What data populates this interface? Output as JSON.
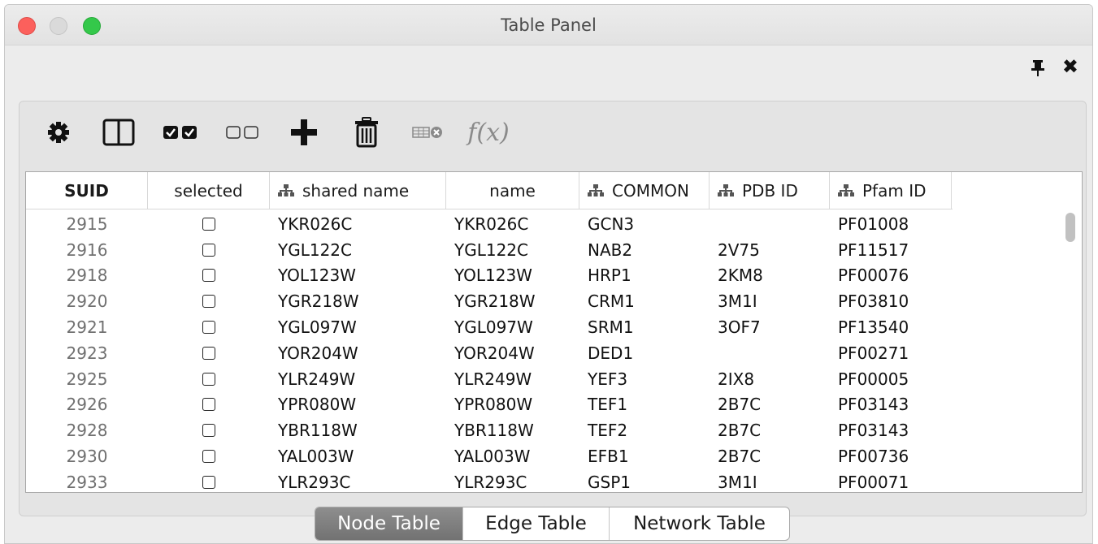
{
  "window": {
    "title": "Table Panel"
  },
  "toolbar": {
    "items": [
      {
        "icon": "gear-icon"
      },
      {
        "icon": "column-layout-icon"
      },
      {
        "icon": "select-all-icon"
      },
      {
        "icon": "deselect-all-icon"
      },
      {
        "icon": "add-icon"
      },
      {
        "icon": "trash-icon"
      },
      {
        "icon": "delete-table-icon"
      },
      {
        "icon": "function-builder-icon",
        "label": "f(x)"
      }
    ]
  },
  "table": {
    "columns": [
      {
        "label": "SUID",
        "tree": false
      },
      {
        "label": "selected",
        "tree": false
      },
      {
        "label": "shared name",
        "tree": true
      },
      {
        "label": "name",
        "tree": false
      },
      {
        "label": "COMMON",
        "tree": true
      },
      {
        "label": "PDB ID",
        "tree": true
      },
      {
        "label": "Pfam ID",
        "tree": true
      }
    ],
    "rows": [
      {
        "suid": "2915",
        "selected": false,
        "shared_name": "YKR026C",
        "name": "YKR026C",
        "common": "GCN3",
        "pdb": "",
        "pfam": "PF01008"
      },
      {
        "suid": "2916",
        "selected": false,
        "shared_name": "YGL122C",
        "name": "YGL122C",
        "common": "NAB2",
        "pdb": "2V75",
        "pfam": "PF11517"
      },
      {
        "suid": "2918",
        "selected": false,
        "shared_name": "YOL123W",
        "name": "YOL123W",
        "common": "HRP1",
        "pdb": "2KM8",
        "pfam": "PF00076"
      },
      {
        "suid": "2920",
        "selected": false,
        "shared_name": "YGR218W",
        "name": "YGR218W",
        "common": "CRM1",
        "pdb": "3M1I",
        "pfam": "PF03810"
      },
      {
        "suid": "2921",
        "selected": false,
        "shared_name": "YGL097W",
        "name": "YGL097W",
        "common": "SRM1",
        "pdb": "3OF7",
        "pfam": "PF13540"
      },
      {
        "suid": "2923",
        "selected": false,
        "shared_name": "YOR204W",
        "name": "YOR204W",
        "common": "DED1",
        "pdb": "",
        "pfam": "PF00271"
      },
      {
        "suid": "2925",
        "selected": false,
        "shared_name": "YLR249W",
        "name": "YLR249W",
        "common": "YEF3",
        "pdb": "2IX8",
        "pfam": "PF00005"
      },
      {
        "suid": "2926",
        "selected": false,
        "shared_name": "YPR080W",
        "name": "YPR080W",
        "common": "TEF1",
        "pdb": "2B7C",
        "pfam": "PF03143"
      },
      {
        "suid": "2928",
        "selected": false,
        "shared_name": "YBR118W",
        "name": "YBR118W",
        "common": "TEF2",
        "pdb": "2B7C",
        "pfam": "PF03143"
      },
      {
        "suid": "2930",
        "selected": false,
        "shared_name": "YAL003W",
        "name": "YAL003W",
        "common": "EFB1",
        "pdb": "2B7C",
        "pfam": "PF00736"
      },
      {
        "suid": "2933",
        "selected": false,
        "shared_name": "YLR293C",
        "name": "YLR293C",
        "common": "GSP1",
        "pdb": "3M1I",
        "pfam": "PF00071"
      }
    ]
  },
  "tabs": [
    {
      "label": "Node Table",
      "active": true
    },
    {
      "label": "Edge Table",
      "active": false
    },
    {
      "label": "Network Table",
      "active": false
    }
  ],
  "colors": {
    "window_bg": "#ececec",
    "active_tab": "#7f7f7f",
    "close": "#fc605c",
    "maximize": "#34c84a"
  }
}
